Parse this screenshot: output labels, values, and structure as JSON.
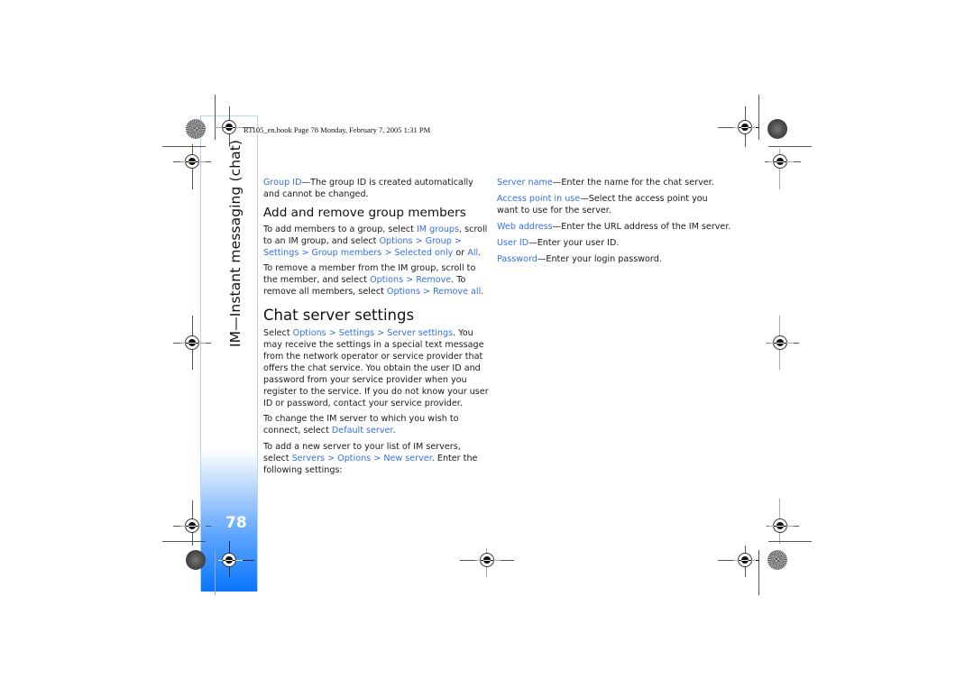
{
  "header": {
    "book_line": "R1105_en.book  Page 78  Monday, February 7, 2005  1:31 PM"
  },
  "sidebar": {
    "section_title": "IM—Instant messaging (chat)",
    "page_number": "78"
  },
  "colors": {
    "highlight": "#3470e0",
    "sidebar_blue": "#0a75ff"
  },
  "column1": {
    "group_id": {
      "term": "Group ID",
      "text": "—The group ID is created automatically and cannot be changed."
    },
    "heading_add_remove": "Add and remove group members",
    "add_para": {
      "t1": "To add members to a group, select ",
      "l1": "IM groups",
      "t2": ", scroll to an IM group, and select ",
      "l2": "Options > Group > Settings > Group members > Selected only",
      "t3": " or ",
      "l3": "All",
      "t4": "."
    },
    "remove_para": {
      "t1": "To remove a member from the IM group, scroll to the member, and select ",
      "l1": "Options > Remove",
      "t2": ". To remove all members, select ",
      "l2": "Options > Remove all",
      "t3": "."
    },
    "heading_chat": "Chat server settings",
    "chat_para": {
      "t1": "Select ",
      "l1": "Options > Settings > Server settings",
      "t2": ". You may receive the settings in a special text message from the network operator or service provider that offers the chat service. You obtain the user ID and password from your service provider when you register to the service. If you do not know your user ID or password, contact your service provider."
    },
    "default_para": {
      "t1": "To change the IM server to which you wish to connect, select ",
      "l1": "Default server",
      "t2": "."
    },
    "new_server_para": {
      "t1": "To add a new server to your list of IM servers, select ",
      "l1": "Servers > Options > New server",
      "t2": ". Enter the following settings:"
    }
  },
  "column2": {
    "settings": [
      {
        "term": "Server name",
        "text": "—Enter the name for the chat server."
      },
      {
        "term": "Access point in use",
        "text": "—Select the access point you want to use for the server."
      },
      {
        "term": "Web address",
        "text": "—Enter the URL address of the IM server."
      },
      {
        "term": "User ID",
        "text": "—Enter your user ID."
      },
      {
        "term": "Password",
        "text": "—Enter your login password."
      }
    ]
  }
}
